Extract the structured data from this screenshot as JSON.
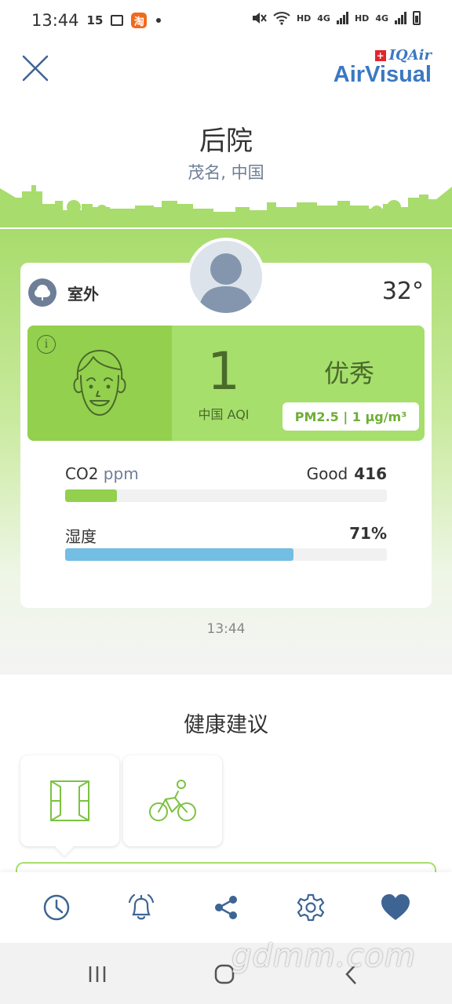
{
  "status_bar": {
    "time": "13:44",
    "notification_count": "15",
    "taobao_label": "淘",
    "hd1": "HD",
    "net1": "4G",
    "hd2": "HD",
    "net2": "4G"
  },
  "header": {
    "close_icon": "close-icon",
    "logo_brand": "IQAir",
    "logo_product": "AirVisual"
  },
  "location": {
    "name": "后院",
    "subtitle": "茂名, 中国"
  },
  "card": {
    "source_label": "室外",
    "temperature": "32°",
    "aqi_value": "1",
    "aqi_label": "中国 AQI",
    "aqi_level": "优秀",
    "pollutant_badge": "PM2.5 | 1 µg/m³",
    "colors": {
      "aqi_bg": "#a6df6c",
      "face_bg": "#93d04e",
      "text": "#4a6a2a"
    },
    "co2": {
      "label": "CO2",
      "unit": "ppm",
      "status": "Good",
      "value": "416",
      "level_fraction": 0.16,
      "color": "#93d04e"
    },
    "humidity": {
      "label": "湿度",
      "value": "71%",
      "level_fraction": 0.71,
      "color": "#74bde3"
    }
  },
  "update_time": "13:44",
  "health": {
    "title": "健康建议",
    "tiles": [
      {
        "icon": "window-icon"
      },
      {
        "icon": "cycling-icon"
      }
    ]
  },
  "bottom_nav": [
    {
      "icon": "history-icon"
    },
    {
      "icon": "alarm-icon"
    },
    {
      "icon": "share-icon"
    },
    {
      "icon": "settings-icon"
    },
    {
      "icon": "favorite-icon"
    }
  ],
  "watermark": "gdmm.com"
}
